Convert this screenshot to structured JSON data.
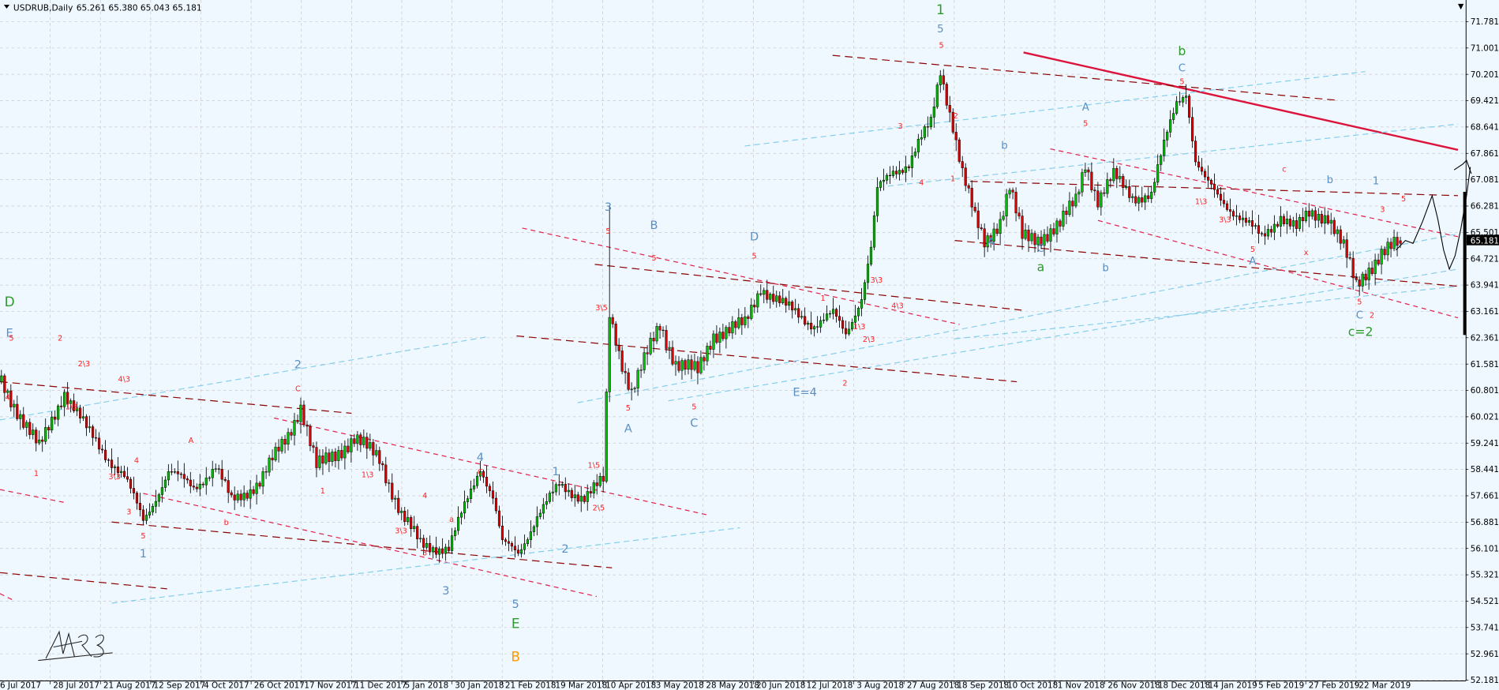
{
  "header": {
    "symbol": "USDRUB,Daily",
    "ohlc": "65.261 65.380 65.043 65.181"
  },
  "colors": {
    "background": "#f0f8ff",
    "grid": "#c8c8c8",
    "bull": "#00c000",
    "bear": "#e00000",
    "wave_green": "#2e9a2e",
    "wave_blue": "#5a8fc4",
    "wave_red": "#ff2020",
    "wave_orange": "#ff9900"
  },
  "current_price_label": "65.181",
  "chart_data": {
    "type": "candlestick",
    "title": "USDRUB,Daily",
    "symbol": "USDRUB",
    "timeframe": "Daily",
    "last_bar": {
      "open": 65.261,
      "high": 65.38,
      "low": 65.043,
      "close": 65.181
    },
    "ylim": [
      52.181,
      71.781
    ],
    "y_ticks": [
      "71.781",
      "71.001",
      "70.201",
      "69.421",
      "68.641",
      "67.861",
      "67.081",
      "66.281",
      "65.501",
      "64.721",
      "63.941",
      "63.161",
      "62.361",
      "61.581",
      "60.801",
      "60.021",
      "59.241",
      "58.441",
      "57.661",
      "56.881",
      "56.101",
      "55.321",
      "54.521",
      "53.741",
      "52.961",
      "52.181"
    ],
    "x_ticks": [
      "6 Jul 2017",
      "28 Jul 2017",
      "21 Aug 2017",
      "12 Sep 2017",
      "4 Oct 2017",
      "26 Oct 2017",
      "17 Nov 2017",
      "11 Dec 2017",
      "5 Jan 2018",
      "30 Jan 2018",
      "21 Feb 2018",
      "19 Mar 2018",
      "10 Apr 2018",
      "3 May 2018",
      "28 May 2018",
      "20 Jun 2018",
      "12 Jul 2018",
      "3 Aug 2018",
      "27 Aug 2018",
      "18 Sep 2018",
      "10 Oct 2018",
      "1 Nov 2018",
      "26 Nov 2018",
      "18 Dec 2018",
      "14 Jan 2019",
      "5 Feb 2019",
      "27 Feb 2019",
      "22 Mar 2019"
    ],
    "close_path_bar_price": [
      [
        0,
        61.06
      ],
      [
        12,
        59.07
      ],
      [
        20,
        60.78
      ],
      [
        27,
        59.64
      ],
      [
        39,
        58.22
      ],
      [
        45,
        56.94
      ],
      [
        53,
        58.36
      ],
      [
        61,
        57.94
      ],
      [
        68,
        58.51
      ],
      [
        73,
        57.51
      ],
      [
        82,
        58.08
      ],
      [
        91,
        59.5
      ],
      [
        95,
        60.35
      ],
      [
        100,
        58.51
      ],
      [
        106,
        58.93
      ],
      [
        112,
        59.36
      ],
      [
        120,
        58.79
      ],
      [
        127,
        57.09
      ],
      [
        133,
        56.23
      ],
      [
        142,
        56.09
      ],
      [
        152,
        58.56
      ],
      [
        156,
        57.65
      ],
      [
        159,
        56.23
      ],
      [
        164,
        55.95
      ],
      [
        170,
        57.09
      ],
      [
        177,
        57.94
      ],
      [
        185,
        57.65
      ],
      [
        191,
        58.08
      ],
      [
        193,
        63.05
      ],
      [
        197,
        61.63
      ],
      [
        200,
        60.78
      ],
      [
        209,
        62.77
      ],
      [
        214,
        61.63
      ],
      [
        221,
        61.35
      ],
      [
        226,
        62.48
      ],
      [
        236,
        62.77
      ],
      [
        241,
        63.9
      ],
      [
        248,
        63.34
      ],
      [
        258,
        62.77
      ],
      [
        264,
        63.05
      ],
      [
        268,
        62.48
      ],
      [
        273,
        63.62
      ],
      [
        276,
        65.04
      ],
      [
        278,
        66.74
      ],
      [
        283,
        67.31
      ],
      [
        288,
        67.6
      ],
      [
        291,
        68.16
      ],
      [
        295,
        68.73
      ],
      [
        298,
        70.3
      ],
      [
        302,
        68.73
      ],
      [
        305,
        67.31
      ],
      [
        309,
        65.89
      ],
      [
        312,
        65.18
      ],
      [
        317,
        65.89
      ],
      [
        320,
        66.89
      ],
      [
        324,
        65.33
      ],
      [
        329,
        65.33
      ],
      [
        336,
        65.75
      ],
      [
        341,
        66.46
      ],
      [
        344,
        67.6
      ],
      [
        348,
        66.46
      ],
      [
        353,
        67.17
      ],
      [
        359,
        66.6
      ],
      [
        365,
        66.6
      ],
      [
        370,
        68.45
      ],
      [
        373,
        69.44
      ],
      [
        376,
        69.73
      ],
      [
        379,
        67.6
      ],
      [
        382,
        67.03
      ],
      [
        386,
        66.6
      ],
      [
        394,
        65.89
      ],
      [
        400,
        65.33
      ],
      [
        406,
        66.03
      ],
      [
        411,
        65.61
      ],
      [
        415,
        66.03
      ],
      [
        421,
        66.03
      ],
      [
        426,
        65.04
      ],
      [
        430,
        63.9
      ],
      [
        433,
        64.33
      ],
      [
        438,
        64.9
      ],
      [
        444,
        65.181
      ]
    ],
    "grid": true
  },
  "wave_labels": [
    {
      "t": "1",
      "c": "G"
    },
    {
      "t": "5",
      "c": "B"
    },
    {
      "t": "5",
      "c": "R"
    },
    {
      "t": "b",
      "c": "G"
    },
    {
      "t": "C",
      "c": "B"
    },
    {
      "t": "5",
      "c": "R"
    },
    {
      "t": "D",
      "c": "G"
    },
    {
      "t": "E",
      "c": "B"
    },
    {
      "t": "2",
      "c": "B"
    },
    {
      "t": "4",
      "c": "B"
    },
    {
      "t": "C",
      "c": "R"
    },
    {
      "t": "1",
      "c": "B"
    },
    {
      "t": "3",
      "c": "B"
    },
    {
      "t": "5",
      "c": "R"
    },
    {
      "t": "B",
      "c": "B"
    },
    {
      "t": "5",
      "c": "R"
    },
    {
      "t": "D",
      "c": "B"
    },
    {
      "t": "5",
      "c": "R"
    },
    {
      "t": "a",
      "c": "G"
    },
    {
      "t": "C",
      "c": "B"
    },
    {
      "t": "A",
      "c": "B"
    },
    {
      "t": "A",
      "c": "B"
    },
    {
      "t": "5",
      "c": "R"
    },
    {
      "t": "b",
      "c": "B"
    },
    {
      "t": "b",
      "c": "B"
    },
    {
      "t": "A",
      "c": "B"
    },
    {
      "t": "5",
      "c": "R"
    },
    {
      "t": "b",
      "c": "B"
    },
    {
      "t": "c",
      "c": "R"
    },
    {
      "t": "1",
      "c": "B"
    },
    {
      "t": "5",
      "c": "R"
    },
    {
      "t": "C",
      "c": "B"
    },
    {
      "t": "5",
      "c": "R"
    },
    {
      "t": "c=2",
      "c": "G"
    },
    {
      "t": "E=4",
      "c": "B"
    },
    {
      "t": "A",
      "c": "B"
    },
    {
      "t": "5",
      "c": "R"
    },
    {
      "t": "C",
      "c": "B"
    },
    {
      "t": "5",
      "c": "R"
    },
    {
      "t": "1",
      "c": "B"
    },
    {
      "t": "5",
      "c": "R"
    },
    {
      "t": "3",
      "c": "B"
    },
    {
      "t": "2",
      "c": "B"
    },
    {
      "t": "5",
      "c": "B"
    },
    {
      "t": "E",
      "c": "G"
    },
    {
      "t": "B",
      "c": "O"
    },
    {
      "t": "5",
      "c": "R"
    },
    {
      "t": "2",
      "c": "R"
    },
    {
      "t": "2\\3",
      "c": "R"
    },
    {
      "t": "1\\3",
      "c": "R"
    },
    {
      "t": "4",
      "c": "R"
    },
    {
      "t": "1",
      "c": "R"
    },
    {
      "t": "4\\3",
      "c": "R"
    },
    {
      "t": "3\\3",
      "c": "R"
    },
    {
      "t": "3",
      "c": "R"
    },
    {
      "t": "4",
      "c": "R"
    },
    {
      "t": "A",
      "c": "R"
    },
    {
      "t": "b",
      "c": "R"
    },
    {
      "t": "C",
      "c": "R"
    },
    {
      "t": "1",
      "c": "R"
    },
    {
      "t": "1\\3",
      "c": "R"
    },
    {
      "t": "4",
      "c": "R"
    },
    {
      "t": "3\\3",
      "c": "R"
    },
    {
      "t": "3",
      "c": "R"
    },
    {
      "t": "a",
      "c": "R"
    },
    {
      "t": "1\\5",
      "c": "R"
    },
    {
      "t": "2\\5",
      "c": "R"
    },
    {
      "t": "3\\5",
      "c": "R"
    },
    {
      "t": "3\\3",
      "c": "R"
    },
    {
      "t": "4\\3",
      "c": "R"
    },
    {
      "t": "3",
      "c": "R"
    },
    {
      "t": "4",
      "c": "R"
    },
    {
      "t": "2",
      "c": "R"
    },
    {
      "t": "1",
      "c": "R"
    },
    {
      "t": "1\\3",
      "c": "R"
    },
    {
      "t": "2\\3",
      "c": "R"
    },
    {
      "t": "1",
      "c": "R"
    },
    {
      "t": "2",
      "c": "R"
    },
    {
      "t": "1\\3",
      "c": "R"
    },
    {
      "t": "3\\3",
      "c": "R"
    },
    {
      "t": "x",
      "c": "R"
    },
    {
      "t": "3",
      "c": "R"
    },
    {
      "t": "2",
      "c": "R"
    }
  ]
}
